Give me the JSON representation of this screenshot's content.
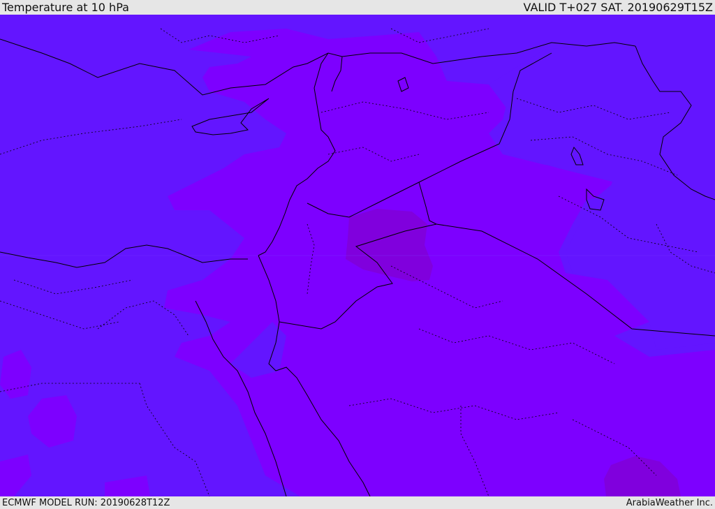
{
  "header": {
    "title": "Temperature at 10 hPa",
    "valid": "VALID T+027 SAT. 20190629T15Z"
  },
  "footer": {
    "model_run": "ECMWF MODEL RUN: 20190628T12Z",
    "credit": "ArabiaWeather Inc."
  },
  "colors": {
    "background_field": "#6315ff",
    "warm_field": "#7d00ff",
    "warmest_field": "#8000dd",
    "borders": "#000000"
  }
}
